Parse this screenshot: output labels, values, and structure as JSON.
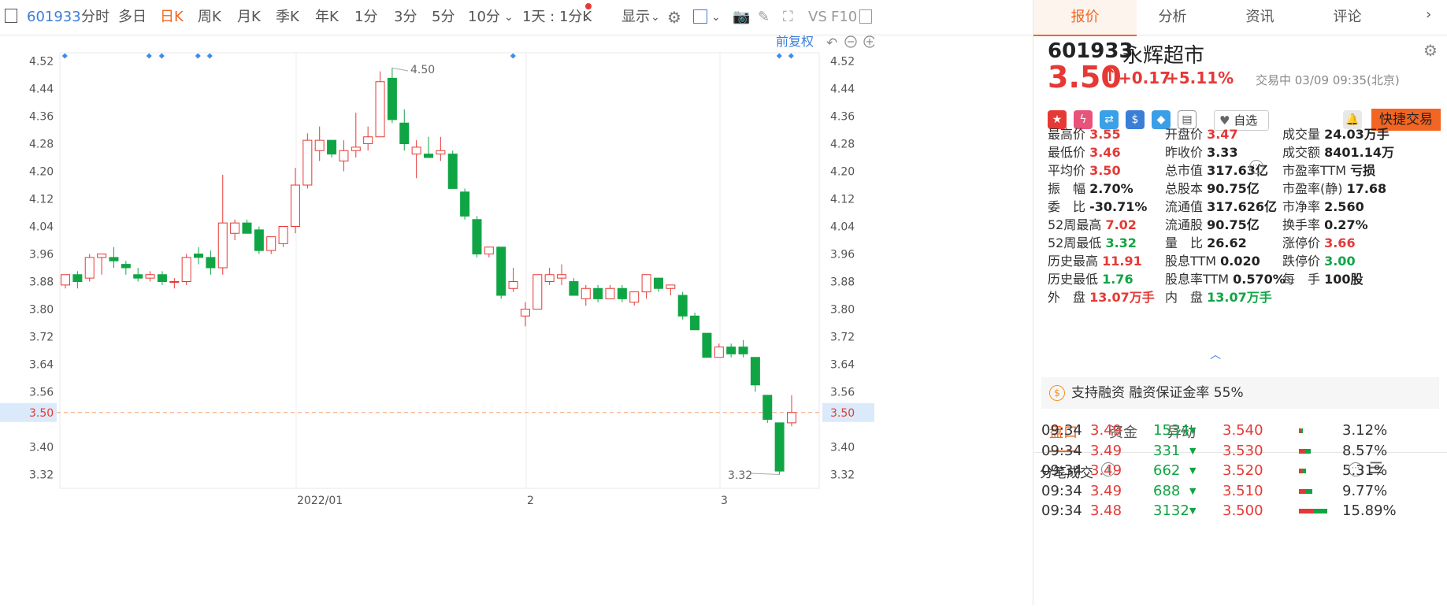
{
  "toolbar": {
    "code": "601933",
    "tabs": [
      "分时",
      "多日",
      "日K",
      "周K",
      "月K",
      "季K",
      "年K",
      "1分",
      "3分",
      "5分",
      "10分"
    ],
    "period_select": "1天 : 1分K",
    "display": "显示",
    "vs": "VS",
    "f10": "F10"
  },
  "chart": {
    "fuquan": "前复权",
    "current_price_label": "3.50",
    "high_label": "4.50",
    "low_label": "3.32",
    "x_labels": [
      "2022/01",
      "2",
      "3"
    ],
    "y_ticks": [
      "4.52",
      "4.44",
      "4.36",
      "4.28",
      "4.20",
      "4.12",
      "4.04",
      "3.96",
      "3.88",
      "3.80",
      "3.72",
      "3.64",
      "3.56",
      "3.40",
      "3.32"
    ]
  },
  "chart_data": {
    "type": "candlestick",
    "y_range": [
      3.28,
      4.56
    ],
    "current_price": 3.5,
    "candles": [
      {
        "o": 3.87,
        "h": 3.9,
        "l": 3.86,
        "c": 3.9
      },
      {
        "o": 3.9,
        "h": 3.91,
        "l": 3.86,
        "c": 3.88
      },
      {
        "o": 3.89,
        "h": 3.96,
        "l": 3.88,
        "c": 3.95
      },
      {
        "o": 3.95,
        "h": 3.96,
        "l": 3.9,
        "c": 3.96
      },
      {
        "o": 3.95,
        "h": 3.98,
        "l": 3.92,
        "c": 3.94
      },
      {
        "o": 3.93,
        "h": 3.94,
        "l": 3.9,
        "c": 3.92
      },
      {
        "o": 3.9,
        "h": 3.92,
        "l": 3.88,
        "c": 3.89
      },
      {
        "o": 3.89,
        "h": 3.91,
        "l": 3.88,
        "c": 3.9
      },
      {
        "o": 3.9,
        "h": 3.91,
        "l": 3.87,
        "c": 3.88
      },
      {
        "o": 3.88,
        "h": 3.89,
        "l": 3.86,
        "c": 3.88
      },
      {
        "o": 3.88,
        "h": 3.96,
        "l": 3.87,
        "c": 3.95
      },
      {
        "o": 3.96,
        "h": 3.98,
        "l": 3.93,
        "c": 3.95
      },
      {
        "o": 3.95,
        "h": 3.97,
        "l": 3.9,
        "c": 3.92
      },
      {
        "o": 3.92,
        "h": 4.19,
        "l": 3.9,
        "c": 4.05
      },
      {
        "o": 4.02,
        "h": 4.06,
        "l": 4.0,
        "c": 4.05
      },
      {
        "o": 4.05,
        "h": 4.06,
        "l": 4.02,
        "c": 4.02
      },
      {
        "o": 4.03,
        "h": 4.04,
        "l": 3.96,
        "c": 3.97
      },
      {
        "o": 3.97,
        "h": 4.01,
        "l": 3.96,
        "c": 4.01
      },
      {
        "o": 3.99,
        "h": 4.04,
        "l": 3.98,
        "c": 4.04
      },
      {
        "o": 4.04,
        "h": 4.21,
        "l": 4.02,
        "c": 4.16
      },
      {
        "o": 4.16,
        "h": 4.31,
        "l": 4.15,
        "c": 4.29
      },
      {
        "o": 4.26,
        "h": 4.33,
        "l": 4.23,
        "c": 4.29
      },
      {
        "o": 4.29,
        "h": 4.29,
        "l": 4.24,
        "c": 4.25
      },
      {
        "o": 4.23,
        "h": 4.29,
        "l": 4.2,
        "c": 4.26
      },
      {
        "o": 4.26,
        "h": 4.37,
        "l": 4.24,
        "c": 4.27
      },
      {
        "o": 4.28,
        "h": 4.33,
        "l": 4.26,
        "c": 4.3
      },
      {
        "o": 4.3,
        "h": 4.49,
        "l": 4.3,
        "c": 4.46
      },
      {
        "o": 4.47,
        "h": 4.5,
        "l": 4.34,
        "c": 4.35
      },
      {
        "o": 4.34,
        "h": 4.38,
        "l": 4.26,
        "c": 4.28
      },
      {
        "o": 4.25,
        "h": 4.29,
        "l": 4.18,
        "c": 4.27
      },
      {
        "o": 4.25,
        "h": 4.3,
        "l": 4.24,
        "c": 4.24
      },
      {
        "o": 4.25,
        "h": 4.3,
        "l": 4.23,
        "c": 4.26
      },
      {
        "o": 4.25,
        "h": 4.26,
        "l": 4.15,
        "c": 4.15
      },
      {
        "o": 4.14,
        "h": 4.15,
        "l": 4.06,
        "c": 4.07
      },
      {
        "o": 4.06,
        "h": 4.07,
        "l": 3.95,
        "c": 3.96
      },
      {
        "o": 3.96,
        "h": 3.98,
        "l": 3.95,
        "c": 3.98
      },
      {
        "o": 3.98,
        "h": 3.98,
        "l": 3.83,
        "c": 3.84
      },
      {
        "o": 3.86,
        "h": 3.92,
        "l": 3.85,
        "c": 3.88
      },
      {
        "o": 3.78,
        "h": 3.82,
        "l": 3.75,
        "c": 3.8
      },
      {
        "o": 3.8,
        "h": 3.9,
        "l": 3.8,
        "c": 3.9
      },
      {
        "o": 3.88,
        "h": 3.92,
        "l": 3.87,
        "c": 3.9
      },
      {
        "o": 3.89,
        "h": 3.93,
        "l": 3.87,
        "c": 3.9
      },
      {
        "o": 3.88,
        "h": 3.89,
        "l": 3.84,
        "c": 3.84
      },
      {
        "o": 3.83,
        "h": 3.87,
        "l": 3.81,
        "c": 3.86
      },
      {
        "o": 3.86,
        "h": 3.87,
        "l": 3.82,
        "c": 3.83
      },
      {
        "o": 3.83,
        "h": 3.87,
        "l": 3.83,
        "c": 3.86
      },
      {
        "o": 3.86,
        "h": 3.87,
        "l": 3.82,
        "c": 3.83
      },
      {
        "o": 3.82,
        "h": 3.85,
        "l": 3.81,
        "c": 3.85
      },
      {
        "o": 3.85,
        "h": 3.9,
        "l": 3.83,
        "c": 3.9
      },
      {
        "o": 3.89,
        "h": 3.89,
        "l": 3.85,
        "c": 3.86
      },
      {
        "o": 3.86,
        "h": 3.87,
        "l": 3.84,
        "c": 3.87
      },
      {
        "o": 3.84,
        "h": 3.85,
        "l": 3.77,
        "c": 3.78
      },
      {
        "o": 3.78,
        "h": 3.79,
        "l": 3.74,
        "c": 3.74
      },
      {
        "o": 3.73,
        "h": 3.73,
        "l": 3.66,
        "c": 3.66
      },
      {
        "o": 3.66,
        "h": 3.7,
        "l": 3.66,
        "c": 3.69
      },
      {
        "o": 3.69,
        "h": 3.7,
        "l": 3.66,
        "c": 3.67
      },
      {
        "o": 3.69,
        "h": 3.71,
        "l": 3.66,
        "c": 3.67
      },
      {
        "o": 3.66,
        "h": 3.66,
        "l": 3.56,
        "c": 3.58
      },
      {
        "o": 3.55,
        "h": 3.55,
        "l": 3.47,
        "c": 3.48
      },
      {
        "o": 3.47,
        "h": 3.47,
        "l": 3.32,
        "c": 3.33
      },
      {
        "o": 3.47,
        "h": 3.55,
        "l": 3.46,
        "c": 3.5
      }
    ]
  },
  "quote": {
    "code": "601933",
    "name": "永辉超市",
    "price": "3.50",
    "change": "+0.17",
    "change_pct": "+5.11%",
    "status": "交易中 03/09 09:35(北京)",
    "watch": "自选",
    "fast_trade": "快捷交易"
  },
  "right_tabs": [
    "报价",
    "分析",
    "资讯",
    "评论"
  ],
  "stats": [
    [
      {
        "k": "最高价",
        "v": "3.55",
        "c": "red"
      },
      {
        "k": "开盘价",
        "v": "3.47",
        "c": "red"
      },
      {
        "k": "成交量",
        "v": "24.03万手",
        "c": ""
      }
    ],
    [
      {
        "k": "最低价",
        "v": "3.46",
        "c": "red"
      },
      {
        "k": "昨收价",
        "v": "3.33",
        "c": ""
      },
      {
        "k": "成交额",
        "v": "8401.14万",
        "c": ""
      }
    ],
    [
      {
        "k": "平均价",
        "v": "3.50",
        "c": "red"
      },
      {
        "k": "总市值",
        "v": "317.63亿",
        "c": ""
      },
      {
        "k": "市盈率TTM",
        "v": "亏损",
        "c": ""
      }
    ],
    [
      {
        "k": "振　幅",
        "v": "2.70%",
        "c": ""
      },
      {
        "k": "总股本",
        "v": "90.75亿",
        "c": ""
      },
      {
        "k": "市盈率(静)",
        "v": "17.68",
        "c": ""
      }
    ],
    [
      {
        "k": "委　比",
        "v": "-30.71%",
        "c": ""
      },
      {
        "k": "流通值",
        "v": "317.626亿",
        "c": ""
      },
      {
        "k": "市净率",
        "v": "2.560",
        "c": ""
      }
    ],
    [
      {
        "k": "52周最高",
        "v": "7.02",
        "c": "red"
      },
      {
        "k": "流通股",
        "v": "90.75亿",
        "c": ""
      },
      {
        "k": "换手率",
        "v": "0.27%",
        "c": ""
      }
    ],
    [
      {
        "k": "52周最低",
        "v": "3.32",
        "c": "green"
      },
      {
        "k": "量　比",
        "v": "26.62",
        "c": ""
      },
      {
        "k": "涨停价",
        "v": "3.66",
        "c": "red"
      }
    ],
    [
      {
        "k": "历史最高",
        "v": "11.91",
        "c": "red"
      },
      {
        "k": "股息TTM",
        "v": "0.020",
        "c": ""
      },
      {
        "k": "跌停价",
        "v": "3.00",
        "c": "green"
      }
    ],
    [
      {
        "k": "历史最低",
        "v": "1.76",
        "c": "green"
      },
      {
        "k": "股息率TTM",
        "v": "0.570%",
        "c": ""
      },
      {
        "k": "每　手",
        "v": "100股",
        "c": ""
      }
    ],
    [
      {
        "k": "外　盘",
        "v": "13.07万手",
        "c": "red"
      },
      {
        "k": "内　盘",
        "v": "13.07万手",
        "c": "green"
      },
      {
        "k": "",
        "v": "",
        "c": ""
      }
    ]
  ],
  "margin_text": "支持融资 融资保证金率 55%",
  "sub_tabs": [
    "盘口",
    "资金",
    "异动"
  ],
  "trades_title": "分笔成交",
  "trades": [
    {
      "time": "09:34",
      "price": "3.49",
      "vol": "1534",
      "p2": "3.540",
      "pct": "3.12%",
      "bar": 0.12
    },
    {
      "time": "09:34",
      "price": "3.49",
      "vol": "331",
      "p2": "3.530",
      "pct": "8.57%",
      "bar": 0.38
    },
    {
      "time": "09:34",
      "price": "3.49",
      "vol": "662",
      "p2": "3.520",
      "pct": "5.31%",
      "bar": 0.23
    },
    {
      "time": "09:34",
      "price": "3.49",
      "vol": "688",
      "p2": "3.510",
      "pct": "9.77%",
      "bar": 0.43
    },
    {
      "time": "09:34",
      "price": "3.48",
      "vol": "3132",
      "p2": "3.500",
      "pct": "15.89%",
      "bar": 0.9
    }
  ]
}
